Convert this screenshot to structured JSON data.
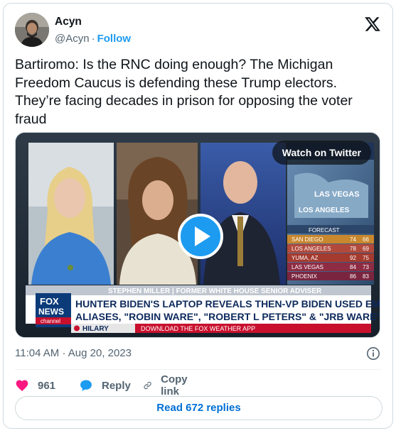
{
  "author": {
    "display_name": "Acyn",
    "handle": "@Acyn",
    "separator": "·",
    "follow_label": "Follow"
  },
  "tweet": {
    "text": "Bartiromo: Is the RNC doing enough? The Michigan Freedom Caucus is defending these Trump electors. They’re facing decades in prison for opposing the voter fraud"
  },
  "media": {
    "watch_label": "Watch on Twitter",
    "chyron_name": "STEPHEN MILLER | FORMER WHITE HOUSE SENIOR ADVISER",
    "chyron_line1": "HUNTER BIDEN'S LAPTOP REVEALS THEN-VP BIDEN USED EMAIL",
    "chyron_line2": "ALIASES, \"ROBIN WARE\", \"ROBERT L PETERS\" & \"JRB WARE\"",
    "ticker_left": "HILARY",
    "ticker_right": "DOWNLOAD THE FOX WEATHER APP",
    "network_top": "FOX",
    "network_mid": "NEWS",
    "network_bottom": "channel",
    "weather_city": "LAS VEGAS",
    "weather_city2": "LOS ANGELES",
    "weather_forecast": "FORECAST",
    "weather_rows": [
      {
        "city": "SAN DIEGO",
        "hi": "74",
        "lo": "66"
      },
      {
        "city": "LOS ANGELES",
        "hi": "78",
        "lo": "69"
      },
      {
        "city": "YUMA, AZ",
        "hi": "92",
        "lo": "75"
      },
      {
        "city": "LAS VEGAS",
        "hi": "84",
        "lo": "73"
      },
      {
        "city": "PHOENIX",
        "hi": "86",
        "lo": "83"
      }
    ]
  },
  "meta": {
    "time": "11:04 AM",
    "separator": "·",
    "date": "Aug 20, 2023"
  },
  "actions": {
    "like_count": "961",
    "reply_label": "Reply",
    "copy_label": "Copy link"
  },
  "read_replies_label": "Read 672 replies",
  "colors": {
    "accent": "#1d9bf0",
    "like": "#f91880",
    "link": "#006fd6",
    "muted": "#536471"
  },
  "icons": {
    "logo": "x-logo-icon",
    "info": "info-icon",
    "like": "heart-icon",
    "reply": "reply-bubble-icon",
    "copy": "link-icon",
    "play": "play-icon"
  }
}
